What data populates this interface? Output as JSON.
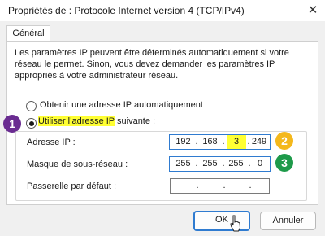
{
  "window": {
    "title": "Propriétés de : Protocole Internet version 4 (TCP/IPv4)",
    "close_symbol": "✕"
  },
  "tabs": [
    {
      "label": "Général"
    }
  ],
  "intro_text": [
    "Les paramètres IP peuvent être déterminés automatiquement si votre",
    "réseau le permet. Sinon, vous devez demander les paramètres IP",
    "appropriés à votre administrateur réseau."
  ],
  "options": {
    "auto_ip": {
      "label": "Obtenir une adresse IP automatiquement",
      "checked": false
    },
    "manual_ip": {
      "label_highlight": "Utiliser l’adresse IP",
      "label_rest": " suivante :",
      "checked": true
    }
  },
  "fields": {
    "ip": {
      "label": "Adresse IP :",
      "octets": [
        "192",
        "168",
        "3",
        "249"
      ]
    },
    "mask": {
      "label": "Masque de sous-réseau :",
      "octets": [
        "255",
        "255",
        "255",
        "0"
      ]
    },
    "gateway": {
      "label": "Passerelle par défaut :",
      "octets": [
        "",
        "",
        "",
        ""
      ]
    }
  },
  "badges": [
    {
      "number": "1",
      "color": "#6a2c91"
    },
    {
      "number": "2",
      "color": "#f4b81c"
    },
    {
      "number": "3",
      "color": "#1e9a4a"
    }
  ],
  "buttons": {
    "ok": "OK",
    "cancel": "Annuler"
  },
  "colors": {
    "highlight": "#ffff33",
    "focus_border": "#2f7bd0"
  }
}
